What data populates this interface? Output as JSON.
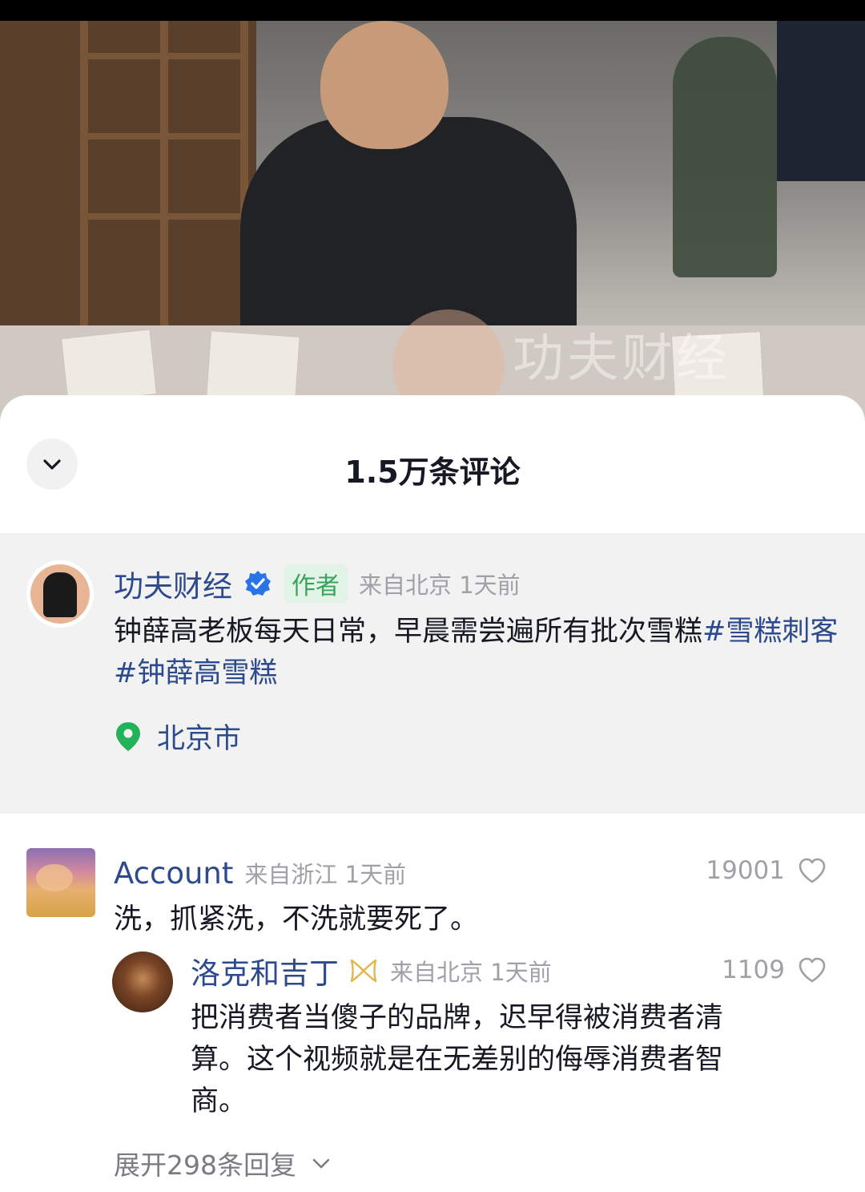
{
  "header": {
    "title": "1.5万条评论"
  },
  "video": {
    "watermark": "功夫财经"
  },
  "author_post": {
    "username": "功夫财经",
    "tag": "作者",
    "location_time": "来自北京 1天前",
    "content_text": "钟薛高老板每天日常，早晨需尝遍所有批次雪糕",
    "hashtag1": "#雪糕刺客",
    "hashtag2": "#钟薛高雪糕",
    "location": "北京市"
  },
  "comments": [
    {
      "username": "Account",
      "meta": "来自浙江 1天前",
      "likes": "19001",
      "text": "洗，抓紧洗，不洗就要死了。",
      "reply": {
        "username": "洛克和吉丁",
        "meta": "来自北京 1天前",
        "likes": "1109",
        "text_line1": "把消费者当傻子的品牌，迟早得被消费者清",
        "text_line2": "算。这个视频就是在无差别的侮辱消费者智",
        "text_line3": "商。"
      },
      "expand_label": "展开298条回复"
    }
  ],
  "colors": {
    "link": "#2c4a8c",
    "author_tag": "#3aa35a",
    "location_pin": "#22b35a",
    "verified": "#2a73e8"
  },
  "icons": [
    "chevron-down-icon",
    "verified-icon",
    "location-pin-icon",
    "heart-icon",
    "bow-badge-icon"
  ]
}
